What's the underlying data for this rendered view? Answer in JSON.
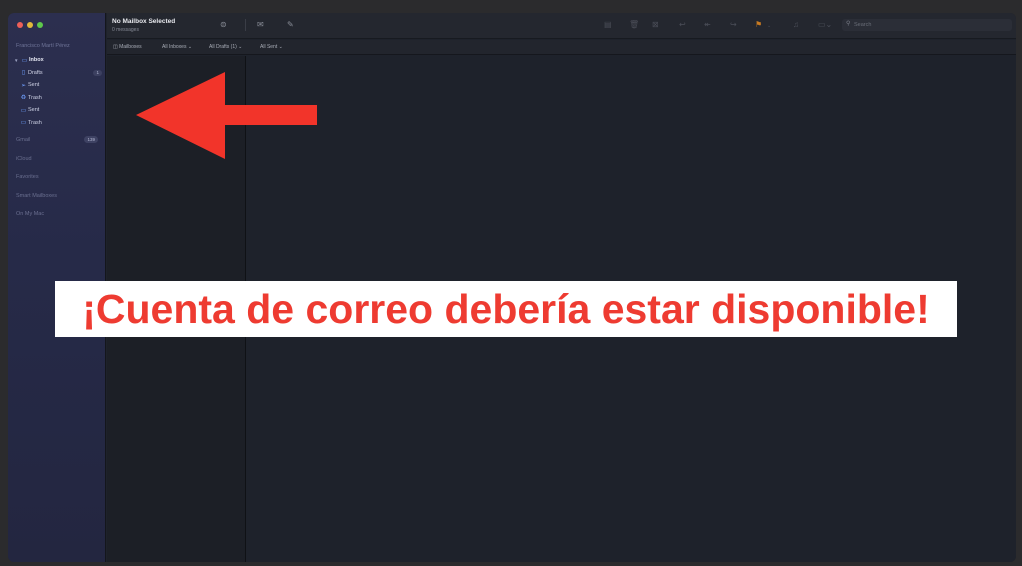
{
  "sidebar": {
    "account_name": "Francisco Martí Pérez",
    "mailboxes": [
      {
        "label": "Inbox",
        "icon": "inbox-icon",
        "glyph": "▭",
        "type": "parent"
      },
      {
        "label": "Drafts",
        "icon": "drafts-icon",
        "glyph": "▯",
        "badge": "1",
        "type": "child"
      },
      {
        "label": "Sent",
        "icon": "sent-icon",
        "glyph": "➢",
        "type": "child"
      },
      {
        "label": "Trash",
        "icon": "trash-icon",
        "glyph": "♻",
        "type": "child"
      },
      {
        "label": "Sent",
        "icon": "sent-folder-icon",
        "glyph": "▭",
        "type": "child"
      },
      {
        "label": "Trash",
        "icon": "trash-folder-icon",
        "glyph": "▭",
        "type": "child"
      }
    ],
    "sections": [
      {
        "label": "Gmail",
        "badge": "139"
      },
      {
        "label": "iCloud"
      },
      {
        "label": "Favorites"
      },
      {
        "label": "Smart Mailboxes"
      },
      {
        "label": "On My Mac"
      }
    ]
  },
  "toolbar": {
    "title": "No Mailbox Selected",
    "subtitle": "0 messages",
    "search_placeholder": "Search"
  },
  "favorites_bar": {
    "mailboxes": "Mailboxes",
    "all_inboxes": "All Inboxes ⌄",
    "all_drafts": "All Drafts (1) ⌄",
    "all_sent": "All Sent ⌄"
  },
  "annotation": {
    "text": "¡Cuenta de correo debería estar disponible!",
    "color": "#ee3b31"
  }
}
